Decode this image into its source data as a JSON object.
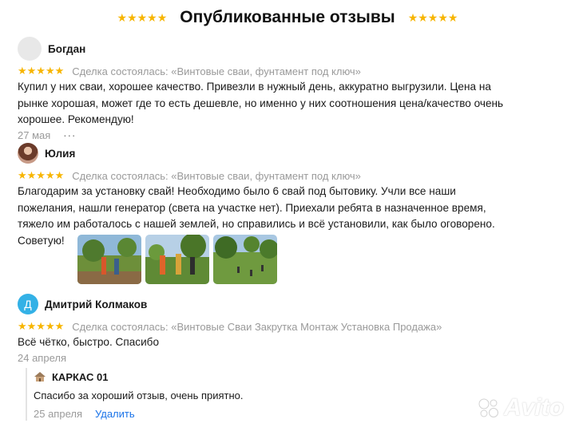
{
  "header": {
    "stars_left": "★★★★★",
    "title": "Опубликованные отзывы",
    "stars_right": "★★★★★"
  },
  "reviews": [
    {
      "name": "Богдан",
      "stars": "★★★★★",
      "deal": "Сделка состоялась: «Винтовые сваи, фунтамент под ключ»",
      "text_lines": [
        "Купил у них сваи, хорошее качество. Привезли в нужный день, аккуратно выгрузили. Цена на",
        "рынке хорошая, может где то есть дешевле, но именно у них соотношения цена/качество очень",
        "хорошее. Рекомендую!"
      ],
      "date": "27 мая",
      "more": "···"
    },
    {
      "name": "Юлия",
      "stars": "★★★★★",
      "deal": "Сделка состоялась: «Винтовые сваи, фунтамент под ключ»",
      "text_lines": [
        "Благодарим за установку свай! Необходимо было 6 свай под бытовику. Учли все наши",
        "пожелания, нашли генератор (света на участке нет). Приехали ребята в назначенное время,",
        "тяжело им работалось с нашей землей, но справились и всё установили, как было оговорено.",
        "Советую!"
      ]
    },
    {
      "name": "Дмитрий Колмаков",
      "avatar_letter": "Д",
      "stars": "★★★★★",
      "deal": "Сделка состоялась: «Винтовые Сваи Закрутка Монтаж Установка Продажа»",
      "text_lines": [
        "Всё чётко, быстро. Спасибо"
      ],
      "date": "24 апреля"
    }
  ],
  "reply": {
    "name": "КАРКАС 01",
    "text": "Спасибо за хороший отзыв, очень приятно.",
    "date": "25 апреля",
    "delete_label": "Удалить"
  },
  "watermark": "Avito",
  "colors": {
    "star": "#f7b500",
    "muted": "#9a9a9a",
    "link": "#1a73e8",
    "avatar_letter_bg": "#33b1e6"
  }
}
